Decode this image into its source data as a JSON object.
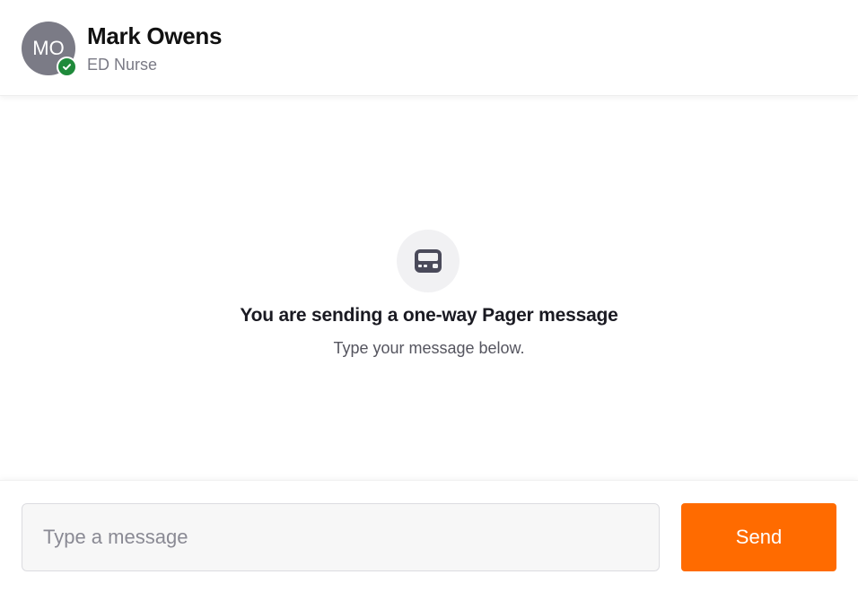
{
  "contact": {
    "initials": "MO",
    "name": "Mark Owens",
    "role": "ED Nurse",
    "status": "available",
    "status_icon": "check-circle-icon",
    "avatar_color": "#7b7b86",
    "status_color": "#1f8a3b"
  },
  "empty_state": {
    "icon": "pager-icon",
    "title": "You are sending a one-way Pager message",
    "subtitle": "Type your message below."
  },
  "composer": {
    "placeholder": "Type a message",
    "value": "",
    "send_label": "Send",
    "send_color": "#ff6b00"
  }
}
